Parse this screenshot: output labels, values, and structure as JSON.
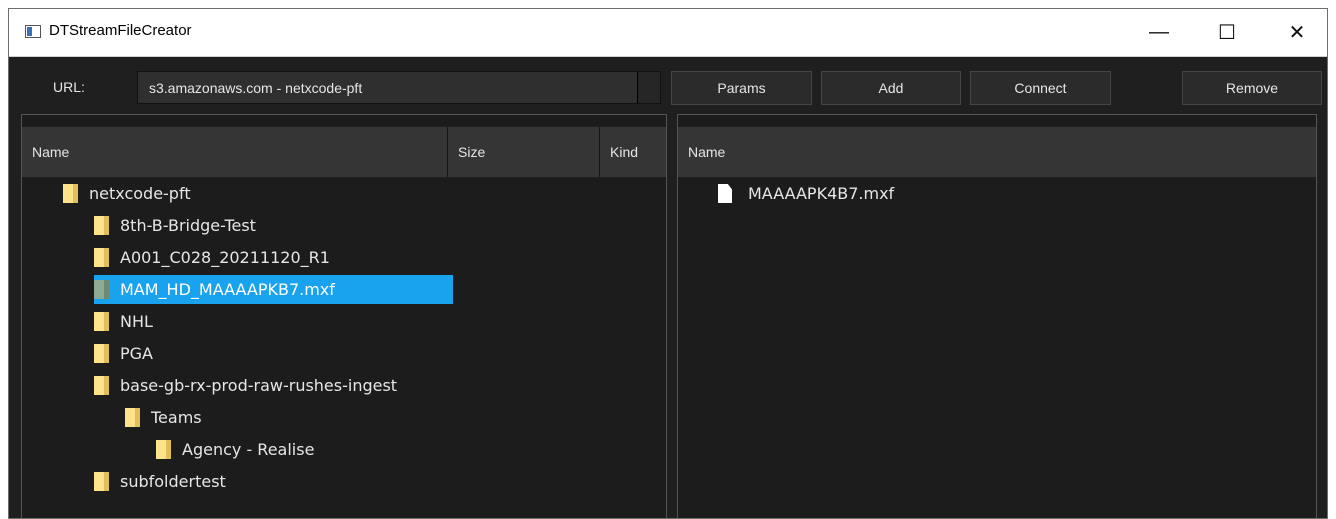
{
  "window": {
    "title": "DTStreamFileCreator",
    "minimize_label": "—",
    "maximize_label": "☐",
    "close_label": "✕"
  },
  "toolbar": {
    "url_label": "URL:",
    "url_value": "s3.amazonaws.com - netxcode-pft",
    "params_label": "Params",
    "add_label": "Add",
    "connect_label": "Connect",
    "remove_label": "Remove"
  },
  "left_panel": {
    "columns": {
      "name": "Name",
      "size": "Size",
      "kind": "Kind"
    },
    "items": [
      {
        "label": "netxcode-pft",
        "icon": "folder-icon"
      },
      {
        "label": "8th-B-Bridge-Test",
        "icon": "folder-icon"
      },
      {
        "label": "A001_C028_20211120_R1",
        "icon": "folder-icon"
      },
      {
        "label": "MAM_HD_MAAAAPKB7.mxf",
        "icon": "folder-icon",
        "selected": true
      },
      {
        "label": "NHL",
        "icon": "folder-icon"
      },
      {
        "label": "PGA",
        "icon": "folder-icon"
      },
      {
        "label": "base-gb-rx-prod-raw-rushes-ingest",
        "icon": "folder-icon"
      },
      {
        "label": "Teams",
        "icon": "folder-icon"
      },
      {
        "label": "Agency - Realise",
        "icon": "folder-icon"
      },
      {
        "label": "subfoldertest",
        "icon": "folder-icon"
      }
    ]
  },
  "right_panel": {
    "columns": {
      "name": "Name"
    },
    "items": [
      {
        "label": "MAAAAPK4B7.mxf",
        "icon": "file-icon"
      }
    ]
  },
  "colors": {
    "selection": "#19a3ef",
    "folder": "#ffe38a",
    "background": "#1c1c1c"
  }
}
